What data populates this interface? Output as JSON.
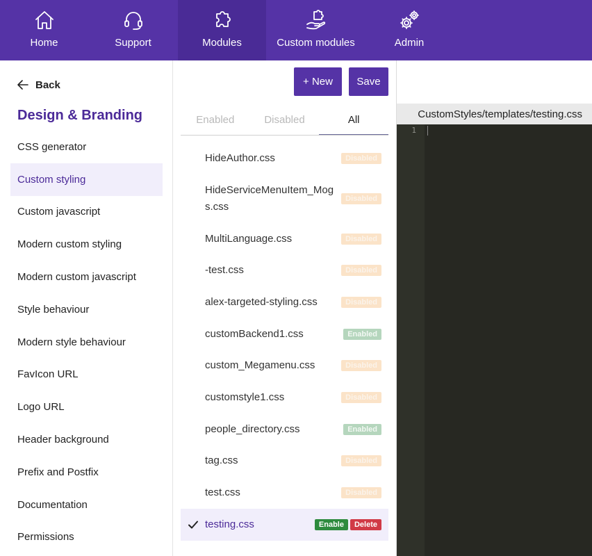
{
  "nav": {
    "items": [
      {
        "label": "Home",
        "icon": "home-icon"
      },
      {
        "label": "Support",
        "icon": "headset-icon"
      },
      {
        "label": "Modules",
        "icon": "puzzle-icon"
      },
      {
        "label": "Custom modules",
        "icon": "hand-puzzle-icon"
      },
      {
        "label": "Admin",
        "icon": "gears-icon"
      }
    ],
    "active": "Modules",
    "color": "#5533a6"
  },
  "sidebar": {
    "back_label": "Back",
    "section_title": "Design & Branding",
    "items": [
      {
        "label": "CSS generator"
      },
      {
        "label": "Custom styling",
        "active": true
      },
      {
        "label": "Custom javascript"
      },
      {
        "label": "Modern custom styling"
      },
      {
        "label": "Modern custom javascript"
      },
      {
        "label": "Style behaviour"
      },
      {
        "label": "Modern style behaviour"
      },
      {
        "label": "FavIcon URL"
      },
      {
        "label": "Logo URL"
      },
      {
        "label": "Header background"
      },
      {
        "label": "Prefix and Postfix"
      },
      {
        "label": "Documentation"
      },
      {
        "label": "Permissions"
      }
    ]
  },
  "toolbar": {
    "new_label": "+ New",
    "save_label": "Save"
  },
  "tabs": {
    "items": [
      {
        "label": "Enabled"
      },
      {
        "label": "Disabled"
      },
      {
        "label": "All",
        "active": true
      }
    ]
  },
  "files": {
    "items": [
      {
        "name": "HideAuthor.css",
        "status": "Disabled"
      },
      {
        "name": "HideServiceMenuItem_Mogs.css",
        "status": "Disabled",
        "tall": true
      },
      {
        "name": "MultiLanguage.css",
        "status": "Disabled"
      },
      {
        "name": "-test.css",
        "status": "Disabled"
      },
      {
        "name": "alex-targeted-styling.css",
        "status": "Disabled"
      },
      {
        "name": "customBackend1.css",
        "status": "Enabled"
      },
      {
        "name": "custom_Megamenu.css",
        "status": "Disabled"
      },
      {
        "name": "customstyle1.css",
        "status": "Disabled"
      },
      {
        "name": "people_directory.css",
        "status": "Enabled"
      },
      {
        "name": "tag.css",
        "status": "Disabled"
      },
      {
        "name": "test.css",
        "status": "Disabled"
      },
      {
        "name": "testing.css",
        "selected": true,
        "actions": [
          "Enable",
          "Delete"
        ]
      }
    ]
  },
  "editor": {
    "path": "CustomStyles/templates/testing.css",
    "line_numbers": [
      "1"
    ],
    "background": "#272822"
  }
}
